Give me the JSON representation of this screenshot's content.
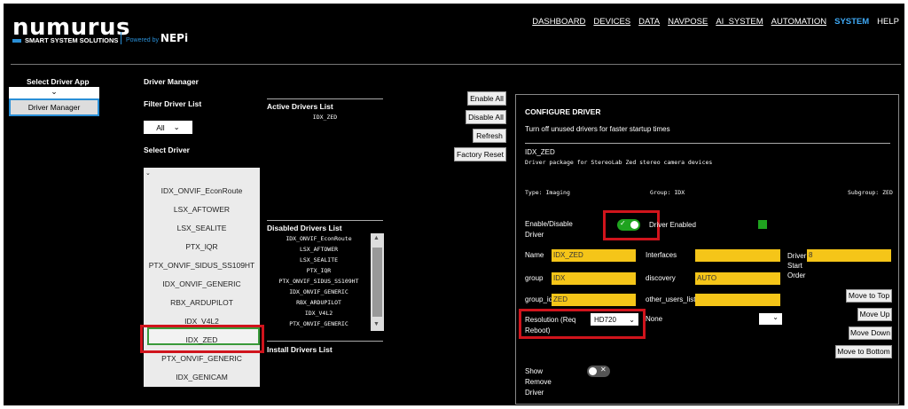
{
  "brand": {
    "name": "numurus",
    "tagline": "SMART SYSTEM SOLUTIONS",
    "powered_by": "Powered by",
    "powered_brand": "NEPi"
  },
  "nav": [
    "DASHBOARD",
    "DEVICES",
    "DATA",
    "NAVPOSE",
    "AI_SYSTEM",
    "AUTOMATION",
    "SYSTEM",
    "HELP"
  ],
  "left": {
    "select_driver_app_label": "Select Driver App",
    "driver_manager_button": "Driver Manager"
  },
  "manager": {
    "title": "Driver Manager",
    "filter_label": "Filter Driver List",
    "filter_value": "All",
    "select_driver_label": "Select Driver",
    "drivers": [
      "IDX_ONVIF_EconRoute",
      "LSX_AFTOWER",
      "LSX_SEALITE",
      "PTX_IQR",
      "PTX_ONVIF_SIDUS_SS109HT",
      "IDX_ONVIF_GENERIC",
      "RBX_ARDUPILOT",
      "IDX_V4L2",
      "IDX_ZED",
      "PTX_ONVIF_GENERIC",
      "IDX_GENICAM"
    ],
    "selected_driver": "IDX_ZED"
  },
  "active_list": {
    "title": "Active Drivers List",
    "items": [
      "IDX_ZED"
    ]
  },
  "disabled_list": {
    "title": "Disabled Drivers List",
    "items": [
      "IDX_ONVIF_EconRoute",
      "LSX_AFTOWER",
      "LSX_SEALITE",
      "PTX_IQR",
      "PTX_ONVIF_SIDUS_SS109HT",
      "IDX_ONVIF_GENERIC",
      "RBX_ARDUPILOT",
      "IDX_V4L2",
      "PTX_ONVIF_GENERIC"
    ]
  },
  "install_list": {
    "title": "Install Drivers List"
  },
  "actions": {
    "enable_all": "Enable All",
    "disable_all": "Disable All",
    "refresh": "Refresh",
    "factory_reset": "Factory Reset"
  },
  "config": {
    "title": "CONFIGURE DRIVER",
    "subtitle": "Turn off unused drivers for faster startup times",
    "driver_name": "IDX_ZED",
    "description": "Driver package for StereoLab Zed stereo camera devices",
    "type": "Type: Imaging",
    "group": "Group: IDX",
    "subgroup": "Subgroup: ZED",
    "enable_label": "Enable/Disable Driver",
    "enabled_text": "Driver Enabled",
    "status_color": "#1fa31f",
    "fields": {
      "name_label": "Name",
      "name_value": "IDX_ZED",
      "interfaces_label": "Interfaces",
      "interfaces_value": "",
      "order_label": "Driver Start Order",
      "order_value": "8",
      "group_label": "group",
      "group_value": "IDX",
      "discovery_label": "discovery",
      "discovery_value": "AUTO",
      "group_id_label": "group_id",
      "group_id_value": "ZED",
      "other_users_label": "other_users_list",
      "other_users_value": ""
    },
    "resolution_label": "Resolution (Req Reboot)",
    "resolution_value": "HD720",
    "none_label": "None",
    "move": {
      "top": "Move to Top",
      "up": "Move Up",
      "down": "Move Down",
      "bottom": "Move to Bottom"
    },
    "show_remove_label": "Show Remove Driver"
  },
  "colors": {
    "accent": "#3fa9f5",
    "highlight": "#d0141c",
    "field": "#f5c518",
    "toggle_on": "#1fa31f"
  }
}
